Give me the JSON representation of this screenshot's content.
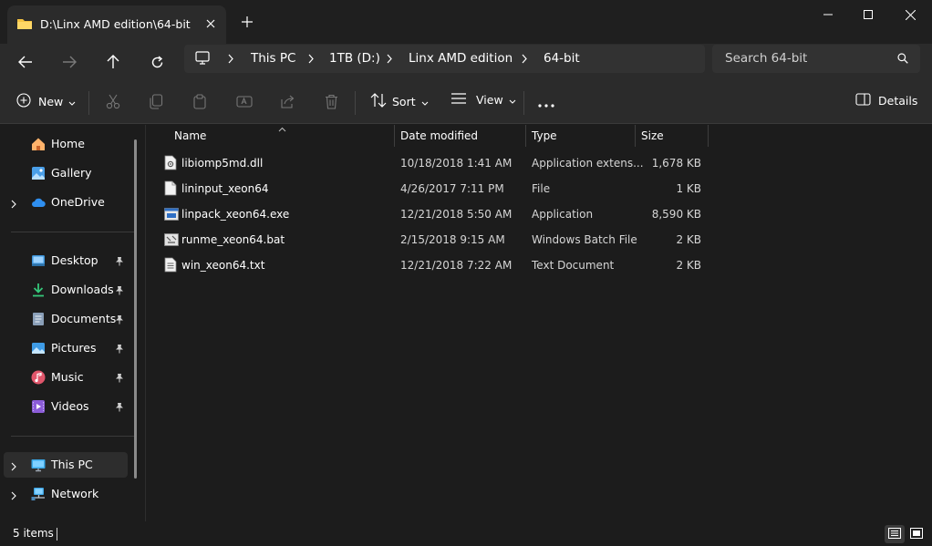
{
  "window": {
    "tab_title": "D:\\Linx AMD edition\\64-bit"
  },
  "address": {
    "crumbs": [
      "This PC",
      "1TB (D:)",
      "Linx AMD edition",
      "64-bit"
    ],
    "search_placeholder": "Search 64-bit"
  },
  "commands": {
    "new": "New",
    "sort": "Sort",
    "view": "View",
    "details": "Details"
  },
  "sidebar": {
    "home": "Home",
    "gallery": "Gallery",
    "onedrive": "OneDrive",
    "desktop": "Desktop",
    "downloads": "Downloads",
    "documents": "Documents",
    "pictures": "Pictures",
    "music": "Music",
    "videos": "Videos",
    "thispc": "This PC",
    "network": "Network"
  },
  "columns": {
    "name": "Name",
    "date": "Date modified",
    "type": "Type",
    "size": "Size"
  },
  "files": [
    {
      "name": "libiomp5md.dll",
      "date": "10/18/2018 1:41 AM",
      "type": "Application extens...",
      "size": "1,678 KB",
      "icon": "dll-file-icon"
    },
    {
      "name": "lininput_xeon64",
      "date": "4/26/2017 7:11 PM",
      "type": "File",
      "size": "1 KB",
      "icon": "generic-file-icon"
    },
    {
      "name": "linpack_xeon64.exe",
      "date": "12/21/2018 5:50 AM",
      "type": "Application",
      "size": "8,590 KB",
      "icon": "exe-file-icon"
    },
    {
      "name": "runme_xeon64.bat",
      "date": "2/15/2018 9:15 AM",
      "type": "Windows Batch File",
      "size": "2 KB",
      "icon": "bat-file-icon"
    },
    {
      "name": "win_xeon64.txt",
      "date": "12/21/2018 7:22 AM",
      "type": "Text Document",
      "size": "2 KB",
      "icon": "txt-file-icon"
    }
  ],
  "status": {
    "items": "5 items"
  },
  "colors": {
    "background": "#1c1c1c",
    "chrome": "#2b2b2b",
    "folder_yellow": "#f5c342",
    "accent_blue": "#4cc2ff"
  }
}
